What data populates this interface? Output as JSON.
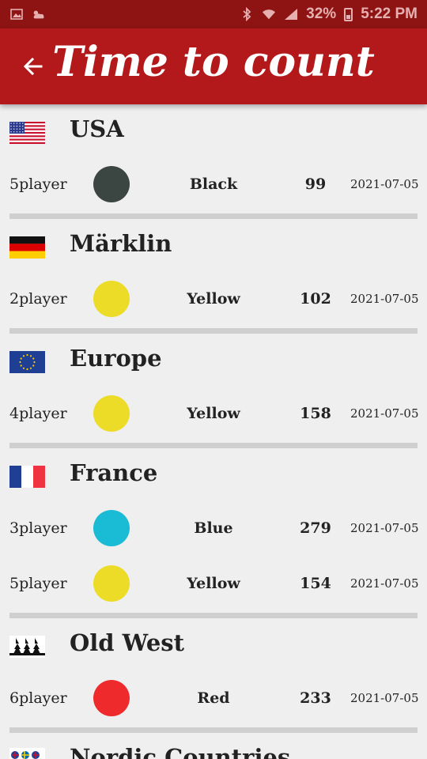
{
  "status": {
    "battery": "32%",
    "time": "5:22 PM"
  },
  "app": {
    "title": "Time to count"
  },
  "icons": {
    "back": "arrow-left-icon"
  },
  "colors": {
    "appbar": "#b3191a",
    "statusbar": "#8e1414",
    "black": "#3b4542",
    "yellow": "#ecdc28",
    "blue": "#19bcd4",
    "red": "#ee2a2c"
  },
  "sections": [
    {
      "name": "USA",
      "flag": "usa",
      "rows": [
        {
          "players": "5player",
          "dot": "#3b4542",
          "color": "Black",
          "score": "99",
          "date": "2021-07-05"
        }
      ]
    },
    {
      "name": "Märklin",
      "flag": "germany",
      "rows": [
        {
          "players": "2player",
          "dot": "#ecdc28",
          "color": "Yellow",
          "score": "102",
          "date": "2021-07-05"
        }
      ]
    },
    {
      "name": "Europe",
      "flag": "eu",
      "rows": [
        {
          "players": "4player",
          "dot": "#ecdc28",
          "color": "Yellow",
          "score": "158",
          "date": "2021-07-05"
        }
      ]
    },
    {
      "name": "France",
      "flag": "france",
      "rows": [
        {
          "players": "3player",
          "dot": "#19bcd4",
          "color": "Blue",
          "score": "279",
          "date": "2021-07-05"
        },
        {
          "players": "5player",
          "dot": "#ecdc28",
          "color": "Yellow",
          "score": "154",
          "date": "2021-07-05"
        }
      ]
    },
    {
      "name": "Old West",
      "flag": "oldwest",
      "rows": [
        {
          "players": "6player",
          "dot": "#ee2a2c",
          "color": "Red",
          "score": "233",
          "date": "2021-07-05"
        }
      ]
    },
    {
      "name": "Nordic Countries",
      "flag": "nordic",
      "rows": []
    }
  ]
}
